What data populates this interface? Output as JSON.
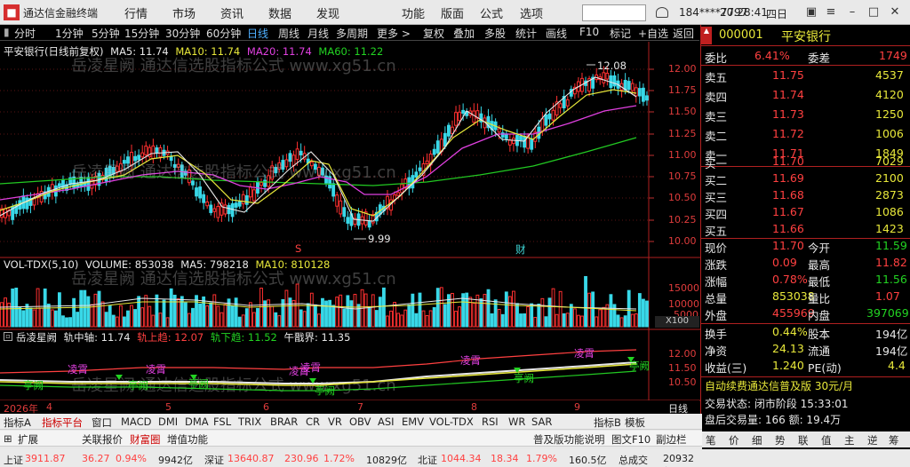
{
  "window": {
    "title": "通达信金融终端",
    "menus": [
      "行情",
      "市场",
      "资讯",
      "数据",
      "发现",
      "功能",
      "版面",
      "公式",
      "选项"
    ],
    "account": "184****7797",
    "time": "20:28:41",
    "close_label": "四日"
  },
  "toolbar": {
    "items": [
      "分时",
      "1分钟",
      "5分钟",
      "15分钟",
      "30分钟",
      "60分钟",
      "日线",
      "周线",
      "月线",
      "多周期",
      "更多 >",
      "复权",
      "叠加",
      "多股",
      "统计",
      "画线",
      "F10",
      "标记",
      "+自选",
      "返回"
    ],
    "active_index": 6
  },
  "chart": {
    "header": {
      "name": "平安银行(日线前复权)",
      "ma5": "MA5: 11.74",
      "ma10": "MA10: 11.74",
      "ma20": "MA20: 11.74",
      "ma60": "MA60: 11.22"
    },
    "high_label": "12.08",
    "low_label": "9.99",
    "marker_s": "S",
    "marker_cai": "财",
    "yaxis": [
      "12.00",
      "11.75",
      "11.50",
      "11.25",
      "11.00",
      "10.75",
      "10.50",
      "10.25",
      "10.00"
    ],
    "xaxis": [
      "2026年",
      "4",
      "5",
      "6",
      "7",
      "8",
      "9"
    ],
    "xaxis_end": "日线"
  },
  "volume": {
    "label": "VOL-TDX(5,10)",
    "volume": "VOLUME: 853038",
    "ma5": "MA5: 798218",
    "ma10": "MA10: 810128",
    "yaxis": [
      "15000",
      "10000",
      "5000"
    ],
    "unit": "X100"
  },
  "indicator": {
    "name": "岳凌星阙",
    "label_axis": "轨中轴: 11.74",
    "label_up": "轨上趋: 12.07",
    "label_down": "轨下趋: 11.52",
    "label_fen": "午戬界: 11.35",
    "yaxis": [
      "12.00",
      "11.50",
      "10.50"
    ],
    "tags_buy": [
      "凌霄",
      "凌霄",
      "凌霄",
      "凌霄",
      "凌霄",
      "凌霄"
    ],
    "tags_sell": [
      "亭阙",
      "亭阙",
      "亭阙",
      "亭阙",
      "亭阙",
      "亭阙"
    ]
  },
  "watermark": "岳凌星阙 通达信选股指标公式 www.xg51.cn",
  "quote": {
    "code": "000001",
    "name": "平安银行",
    "ratio_label": "委比",
    "ratio": "6.41%",
    "diff_label": "委差",
    "diff": "1749",
    "asks": [
      {
        "l": "卖五",
        "p": "11.75",
        "v": "4537"
      },
      {
        "l": "卖四",
        "p": "11.74",
        "v": "4120"
      },
      {
        "l": "卖三",
        "p": "11.73",
        "v": "1250"
      },
      {
        "l": "卖二",
        "p": "11.72",
        "v": "1006"
      },
      {
        "l": "卖一",
        "p": "11.71",
        "v": "1849"
      }
    ],
    "bids": [
      {
        "l": "买一",
        "p": "11.70",
        "v": "7029"
      },
      {
        "l": "买二",
        "p": "11.69",
        "v": "2100"
      },
      {
        "l": "买三",
        "p": "11.68",
        "v": "2873"
      },
      {
        "l": "买四",
        "p": "11.67",
        "v": "1086"
      },
      {
        "l": "买五",
        "p": "11.66",
        "v": "1423"
      }
    ],
    "stats": [
      {
        "l1": "现价",
        "v1": "11.70",
        "l2": "今开",
        "v2": "11.59"
      },
      {
        "l1": "涨跌",
        "v1": "0.09",
        "l2": "最高",
        "v2": "11.82"
      },
      {
        "l1": "涨幅",
        "v1": "0.78%",
        "l2": "最低",
        "v2": "11.56"
      },
      {
        "l1": "总量",
        "v1": "853038",
        "l2": "量比",
        "v2": "1.07"
      },
      {
        "l1": "外盘",
        "v1": "455969",
        "l2": "内盘",
        "v2": "397069"
      }
    ],
    "stats2": [
      {
        "l1": "换手",
        "v1": "0.44%",
        "l2": "股本",
        "v2": "194亿"
      },
      {
        "l1": "净资",
        "v1": "24.13",
        "l2": "流通",
        "v2": "194亿"
      },
      {
        "l1": "收益(三)",
        "v1": "1.240",
        "l2": "PE(动)",
        "v2": "4.4"
      }
    ],
    "promo": "自动续费通达信普及版 30元/月",
    "trade_state": "交易状态: 闭市阶段 15:33:01",
    "after_hours": "盘后交易量: 166  额: 19.4万",
    "bottom_tabs": [
      "笔",
      "价",
      "细",
      "势",
      "联",
      "值",
      "主",
      "逆",
      "筹"
    ]
  },
  "bottom": {
    "tabs1": [
      "指标A",
      "指标平台",
      "窗口",
      "MACD",
      "DMI",
      "DMA",
      "FSL",
      "TRIX",
      "BRAR",
      "CR",
      "VR",
      "OBV",
      "ASI",
      "EMV",
      "VOL-TDX",
      "RSI",
      "WR",
      "SAR",
      "指标B",
      "模板"
    ],
    "tabs2": [
      "扩展",
      "关联报价",
      "财富圈",
      "增值功能"
    ],
    "links": [
      "普及版功能说明",
      "图文F10",
      "副边栏"
    ],
    "status": {
      "sh_label": "上证",
      "sh": "3911.87",
      "sh_chg": "36.27",
      "sh_pct": "0.94%",
      "sh_amt": "9942亿",
      "sz_label": "深证",
      "sz": "13640.87",
      "sz_chg": "230.96",
      "sz_pct": "1.72%",
      "sz_amt": "10829亿",
      "bz_label": "北证",
      "bz": "1044.34",
      "bz_chg": "18.34",
      "bz_pct": "1.79%",
      "bz_amt": "160.5亿",
      "tot_label": "总成交",
      "tot": "20932亿"
    }
  },
  "colors": {
    "red": "#ff4040",
    "green": "#22d322",
    "yellow": "#e8e83a",
    "magenta": "#e040e0",
    "cyan": "#40d8d8"
  }
}
